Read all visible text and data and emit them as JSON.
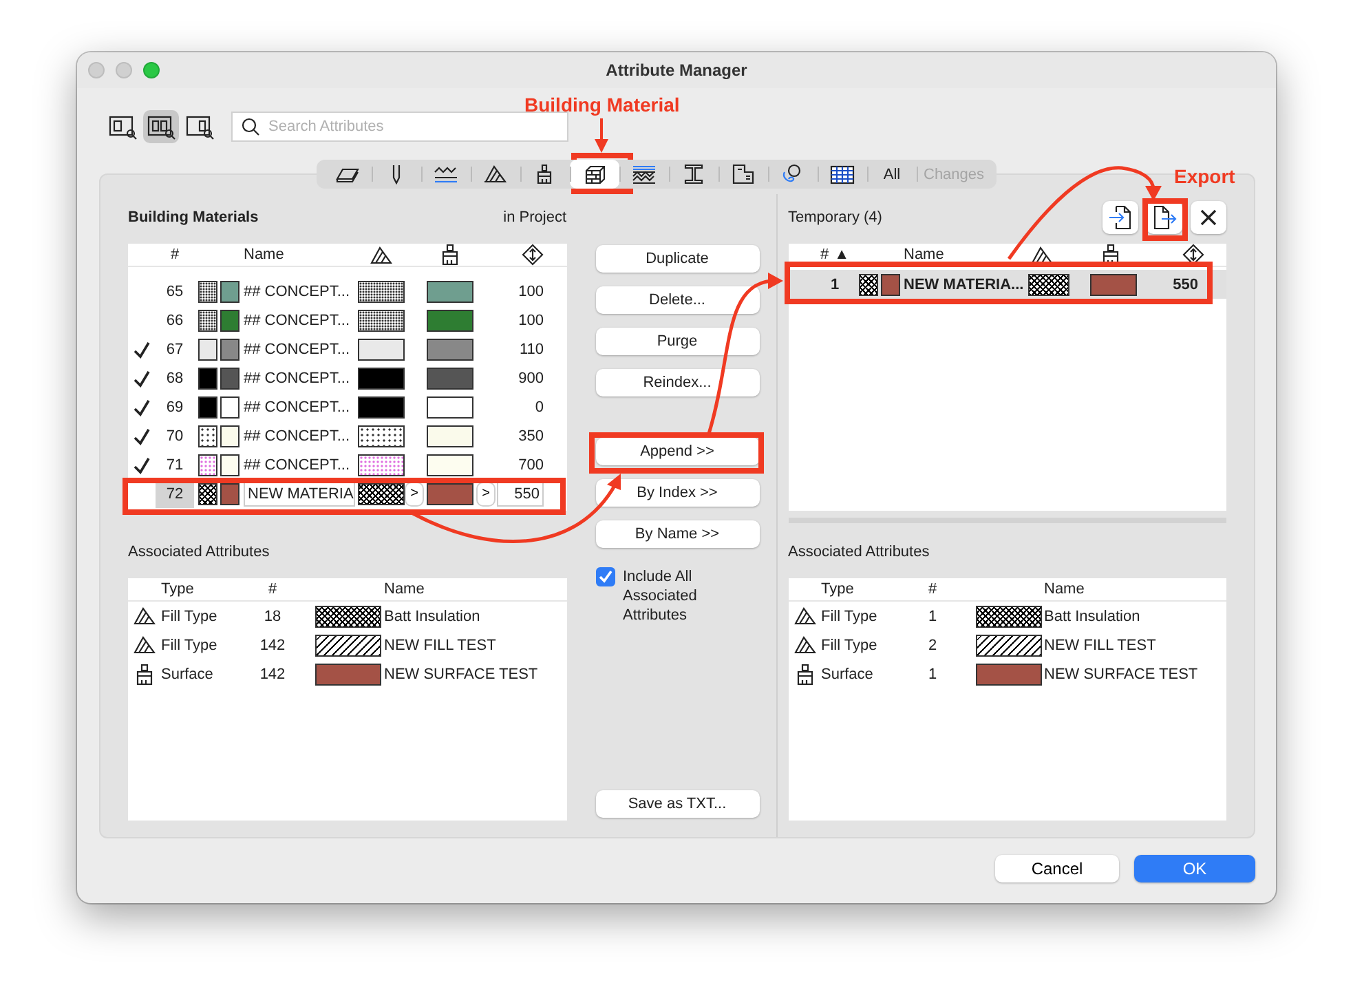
{
  "window": {
    "title": "Attribute Manager"
  },
  "view_buttons": [
    {
      "selected": false
    },
    {
      "selected": true
    },
    {
      "selected": false
    }
  ],
  "search": {
    "placeholder": "Search Attributes"
  },
  "tabs": [
    {
      "kind": "icon",
      "selected": false
    },
    {
      "kind": "icon",
      "selected": false
    },
    {
      "kind": "icon",
      "selected": false
    },
    {
      "kind": "icon",
      "selected": false
    },
    {
      "kind": "icon",
      "selected": false
    },
    {
      "kind": "icon",
      "selected": true
    },
    {
      "kind": "icon",
      "selected": false
    },
    {
      "kind": "icon",
      "selected": false
    },
    {
      "kind": "icon",
      "selected": false
    },
    {
      "kind": "icon",
      "selected": false
    },
    {
      "kind": "icon",
      "selected": false
    },
    {
      "kind": "text",
      "label": "All",
      "selected": false,
      "disabled": false
    },
    {
      "kind": "text",
      "label": "Changes",
      "selected": false,
      "disabled": true
    }
  ],
  "project_panel": {
    "title": "Building Materials",
    "scope": "in Project",
    "columns": [
      "#",
      "Name"
    ],
    "rows": [
      {
        "num": "65",
        "checked": false,
        "kind": "dense",
        "color": "#6f9e8f",
        "name": "## CONCEPT...",
        "value": "100",
        "selected": false,
        "editing": false
      },
      {
        "num": "66",
        "checked": false,
        "kind": "dense",
        "color": "#2e7d32",
        "name": "## CONCEPT...",
        "value": "100",
        "selected": false,
        "editing": false
      },
      {
        "num": "67",
        "checked": true,
        "kind": "light",
        "color": "#888888",
        "name": "## CONCEPT...",
        "value": "110",
        "selected": false,
        "editing": false
      },
      {
        "num": "68",
        "checked": true,
        "kind": "black",
        "color": "#555555",
        "name": "## CONCEPT...",
        "value": "900",
        "selected": false,
        "editing": false
      },
      {
        "num": "69",
        "checked": true,
        "kind": "black",
        "color": "#ffffff",
        "name": "## CONCEPT...",
        "value": "0",
        "selected": false,
        "editing": false
      },
      {
        "num": "70",
        "checked": true,
        "kind": "dots",
        "color": "#fafaeb",
        "name": "## CONCEPT...",
        "value": "350",
        "selected": false,
        "editing": false
      },
      {
        "num": "71",
        "checked": true,
        "kind": "pink",
        "color": "#fdfdf0",
        "name": "## CONCEPT...",
        "value": "700",
        "selected": false,
        "editing": false
      },
      {
        "num": "72",
        "checked": false,
        "kind": "crosshatch",
        "color": "#a45246",
        "name": "NEW MATERIA",
        "value": "550",
        "selected": true,
        "editing": true,
        "pickers": [
          ">",
          ">"
        ]
      }
    ],
    "associated": {
      "title": "Associated Attributes",
      "columns": [
        "Type",
        "#",
        "Name"
      ],
      "rows": [
        {
          "kind": "crosshatch-fill",
          "type": "Fill Type",
          "num": "18",
          "name": "Batt Insulation"
        },
        {
          "kind": "diagonal-fill",
          "type": "Fill Type",
          "num": "142",
          "name": "NEW FILL TEST"
        },
        {
          "kind": "surface",
          "type": "Surface",
          "num": "142",
          "color": "#a45246",
          "name": "NEW SURFACE TEST"
        }
      ]
    }
  },
  "actions": [
    {
      "label": "Duplicate"
    },
    {
      "label": "Delete..."
    },
    {
      "label": "Purge"
    },
    {
      "label": "Reindex..."
    }
  ],
  "append_actions": [
    {
      "label": "Append >>"
    },
    {
      "label": "By Index >>"
    },
    {
      "label": "By Name >>"
    }
  ],
  "include_all": {
    "label": "Include All Associated Attributes",
    "checked": true
  },
  "save_button": "Save as TXT...",
  "temporary_panel": {
    "title": "Temporary (4)",
    "columns": [
      "#",
      "Name"
    ],
    "sort_indicator": "▲",
    "rows": [
      {
        "num": "1",
        "kind": "crosshatch",
        "color": "#a45246",
        "name": "NEW MATERIA...",
        "value": "550",
        "selected": true
      }
    ],
    "associated": {
      "title": "Associated Attributes",
      "columns": [
        "Type",
        "#",
        "Name"
      ],
      "rows": [
        {
          "kind": "crosshatch-fill",
          "type": "Fill Type",
          "num": "1",
          "name": "Batt Insulation"
        },
        {
          "kind": "diagonal-fill",
          "type": "Fill Type",
          "num": "2",
          "name": "NEW FILL TEST"
        },
        {
          "kind": "surface",
          "type": "Surface",
          "num": "1",
          "color": "#a45246",
          "name": "NEW SURFACE TEST"
        }
      ]
    }
  },
  "footer_buttons": [
    {
      "label": "Cancel",
      "kind": "secondary"
    },
    {
      "label": "OK",
      "kind": "primary"
    }
  ],
  "annotations": [
    {
      "label": "Building Material"
    },
    {
      "label": "Export"
    }
  ]
}
